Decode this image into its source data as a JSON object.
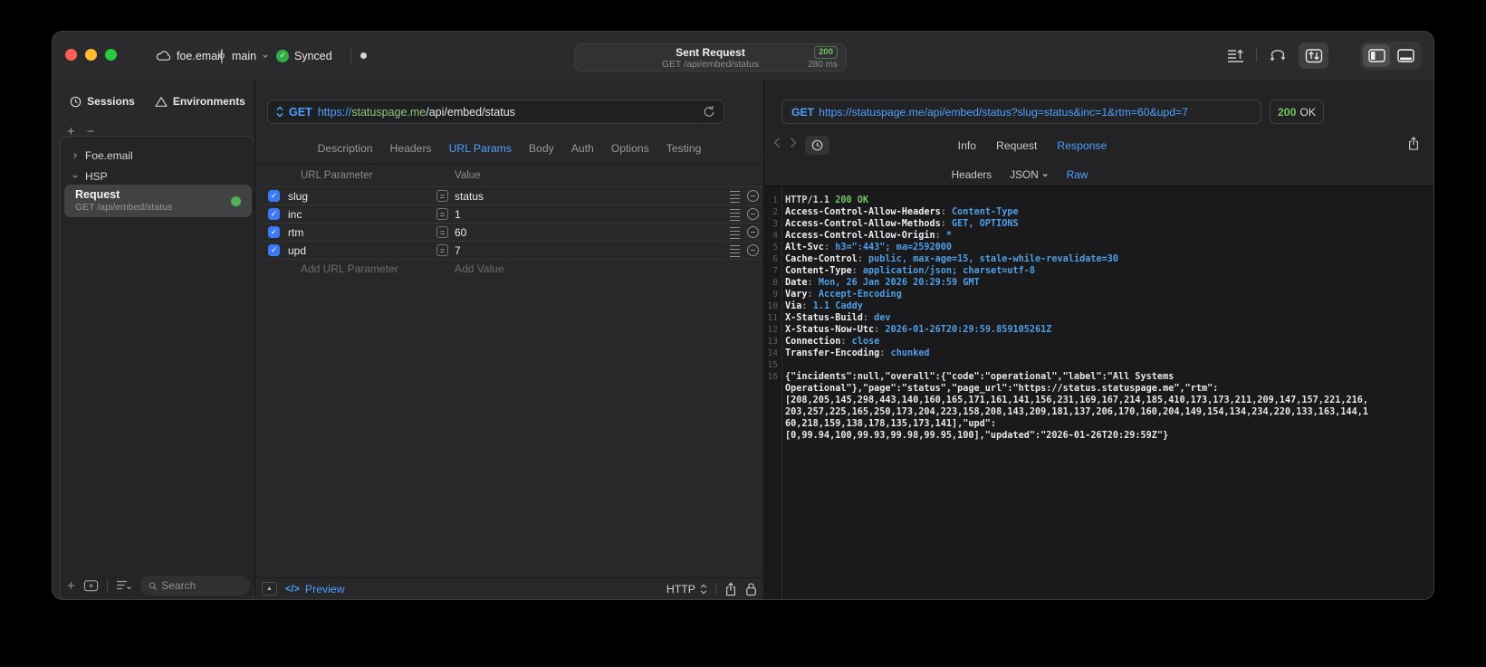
{
  "titlebar": {
    "project": "foe.email",
    "branch": "main",
    "sync_label": "Synced",
    "request_summary": {
      "title": "Sent Request",
      "subtitle": "GET /api/embed/status",
      "status_code": "200",
      "duration": "280 ms"
    }
  },
  "sidebar": {
    "tabs": [
      {
        "label": "Sessions"
      },
      {
        "label": "Environments"
      }
    ],
    "add_glyph": "+",
    "remove_glyph": "−",
    "tree": [
      {
        "label": "Foe.email"
      },
      {
        "label": "HSP"
      }
    ],
    "selected_request": {
      "title": "Request",
      "subtitle": "GET /api/embed/status"
    },
    "search_placeholder": "Search"
  },
  "request_editor": {
    "method": "GET",
    "url": {
      "scheme": "https://",
      "host": "statuspage.me",
      "path": "/api/embed/status"
    },
    "tabs": [
      "Description",
      "Headers",
      "URL Params",
      "Body",
      "Auth",
      "Options",
      "Testing"
    ],
    "active_tab": "URL Params",
    "params_table": {
      "columns": [
        "URL Parameter",
        "Value"
      ],
      "eq_glyph": "=",
      "rows": [
        {
          "enabled": true,
          "name": "slug",
          "value": "status"
        },
        {
          "enabled": true,
          "name": "inc",
          "value": "1"
        },
        {
          "enabled": true,
          "name": "rtm",
          "value": "60"
        },
        {
          "enabled": true,
          "name": "upd",
          "value": "7"
        }
      ],
      "add_param_placeholder": "Add URL Parameter",
      "add_value_placeholder": "Add Value"
    },
    "footer": {
      "code_glyph": "</>",
      "preview_label": "Preview",
      "protocol_label": "HTTP"
    }
  },
  "response_viewer": {
    "method": "GET",
    "url": "https://statuspage.me/api/embed/status?slug=status&inc=1&rtm=60&upd=7",
    "status_code": "200",
    "status_text": "OK",
    "tabs": [
      "Info",
      "Request",
      "Response"
    ],
    "active_tab": "Response",
    "subtabs": [
      "Headers",
      "JSON",
      "Raw"
    ],
    "active_subtab": "Raw",
    "code_lines": [
      [
        "1",
        [
          [
            "HTTP/1.1 ",
            "p"
          ],
          [
            "200 OK",
            "g"
          ]
        ]
      ],
      [
        "2",
        [
          [
            "Access-Control-Allow-Headers",
            "h"
          ],
          [
            ": ",
            "d"
          ],
          [
            "Content-Type",
            "v"
          ]
        ]
      ],
      [
        "3",
        [
          [
            "Access-Control-Allow-Methods",
            "h"
          ],
          [
            ": ",
            "d"
          ],
          [
            "GET, OPTIONS",
            "v"
          ]
        ]
      ],
      [
        "4",
        [
          [
            "Access-Control-Allow-Origin",
            "h"
          ],
          [
            ": ",
            "d"
          ],
          [
            "*",
            "v"
          ]
        ]
      ],
      [
        "5",
        [
          [
            "Alt-Svc",
            "h"
          ],
          [
            ": ",
            "d"
          ],
          [
            "h3=\":443\"; ma=2592000",
            "v"
          ]
        ]
      ],
      [
        "6",
        [
          [
            "Cache-Control",
            "h"
          ],
          [
            ": ",
            "d"
          ],
          [
            "public, max-age=15, stale-while-revalidate=30",
            "v"
          ]
        ]
      ],
      [
        "7",
        [
          [
            "Content-Type",
            "h"
          ],
          [
            ": ",
            "d"
          ],
          [
            "application/json; charset=utf-8",
            "v"
          ]
        ]
      ],
      [
        "8",
        [
          [
            "Date",
            "h"
          ],
          [
            ": ",
            "d"
          ],
          [
            "Mon, 26 Jan 2026 20:29:59 GMT",
            "v"
          ]
        ]
      ],
      [
        "9",
        [
          [
            "Vary",
            "h"
          ],
          [
            ": ",
            "d"
          ],
          [
            "Accept-Encoding",
            "v"
          ]
        ]
      ],
      [
        "10",
        [
          [
            "Via",
            "h"
          ],
          [
            ": ",
            "d"
          ],
          [
            "1.1 Caddy",
            "v"
          ]
        ]
      ],
      [
        "11",
        [
          [
            "X-Status-Build",
            "h"
          ],
          [
            ": ",
            "d"
          ],
          [
            "dev",
            "v"
          ]
        ]
      ],
      [
        "12",
        [
          [
            "X-Status-Now-Utc",
            "h"
          ],
          [
            ": ",
            "d"
          ],
          [
            "2026-01-26T20:29:59.859105261Z",
            "v"
          ]
        ]
      ],
      [
        "13",
        [
          [
            "Connection",
            "h"
          ],
          [
            ": ",
            "d"
          ],
          [
            "close",
            "v"
          ]
        ]
      ],
      [
        "14",
        [
          [
            "Transfer-Encoding",
            "h"
          ],
          [
            ": ",
            "d"
          ],
          [
            "chunked",
            "v"
          ]
        ]
      ],
      [
        "15",
        []
      ],
      [
        "16",
        [
          [
            "{\"incidents\":null,\"overall\":{\"code\":\"operational\",\"label\":\"All Systems",
            "j"
          ]
        ]
      ],
      [
        "",
        [
          [
            "Operational\"},\"page\":\"status\",\"page_url\":\"https://status.statuspage.me\",\"rtm\":",
            "j"
          ]
        ]
      ],
      [
        "",
        [
          [
            "[208,205,145,298,443,140,160,165,171,161,141,156,231,169,167,214,185,410,173,173,211,209,147,157,221,216,",
            "j"
          ]
        ]
      ],
      [
        "",
        [
          [
            "203,257,225,165,250,173,204,223,158,208,143,209,181,137,206,170,160,204,149,154,134,234,220,133,163,144,1",
            "j"
          ]
        ]
      ],
      [
        "",
        [
          [
            "60,218,159,138,178,135,173,141],\"upd\":",
            "j"
          ]
        ]
      ],
      [
        "",
        [
          [
            "[0,99.94,100,99.93,99.98,99.95,100],\"updated\":\"2026-01-26T20:29:59Z\"}",
            "j"
          ]
        ]
      ]
    ]
  },
  "colors": {
    "accent_blue": "#4da0ff",
    "url_host_green": "#93c47d",
    "success_green": "#74c465",
    "checkbox_blue": "#3b7af7",
    "status_dot_green": "#55b054",
    "traffic_red": "#ff5f57",
    "traffic_yellow": "#febc2e",
    "traffic_green": "#28c840"
  }
}
